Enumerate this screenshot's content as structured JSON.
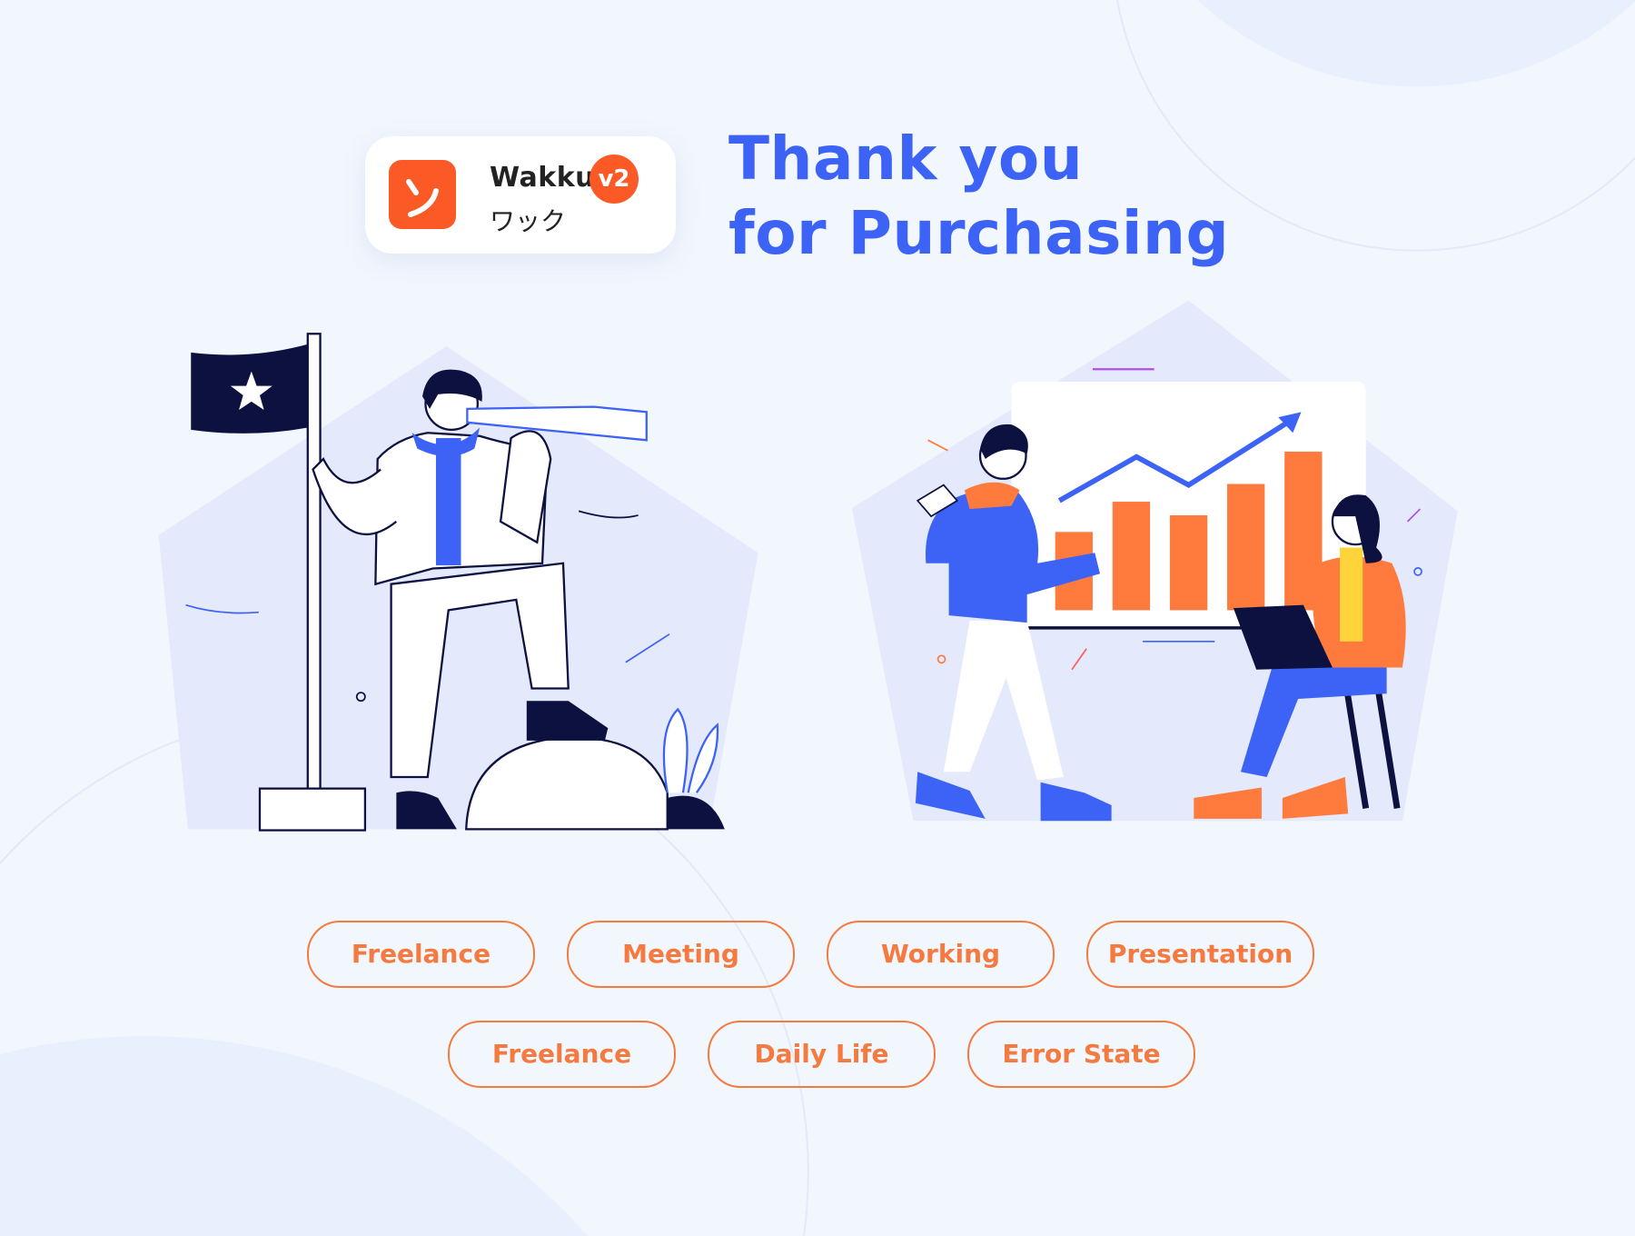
{
  "brand": {
    "name": "Wakku",
    "version_badge": "v2",
    "japanese": "ワック",
    "logo_glyph": "ン",
    "accent": "#fb5a26"
  },
  "title": {
    "line1": "Thank you",
    "line2": "for Purchasing",
    "color": "#3d63f6"
  },
  "illustrations": [
    {
      "name": "explorer-with-flag-and-telescope"
    },
    {
      "name": "presentation-with-bar-chart"
    }
  ],
  "categories": {
    "row1": [
      "Freelance",
      "Meeting",
      "Working",
      "Presentation"
    ],
    "row2": [
      "Freelance",
      "Daily Life",
      "Error State"
    ],
    "color": "#f47a3f"
  }
}
